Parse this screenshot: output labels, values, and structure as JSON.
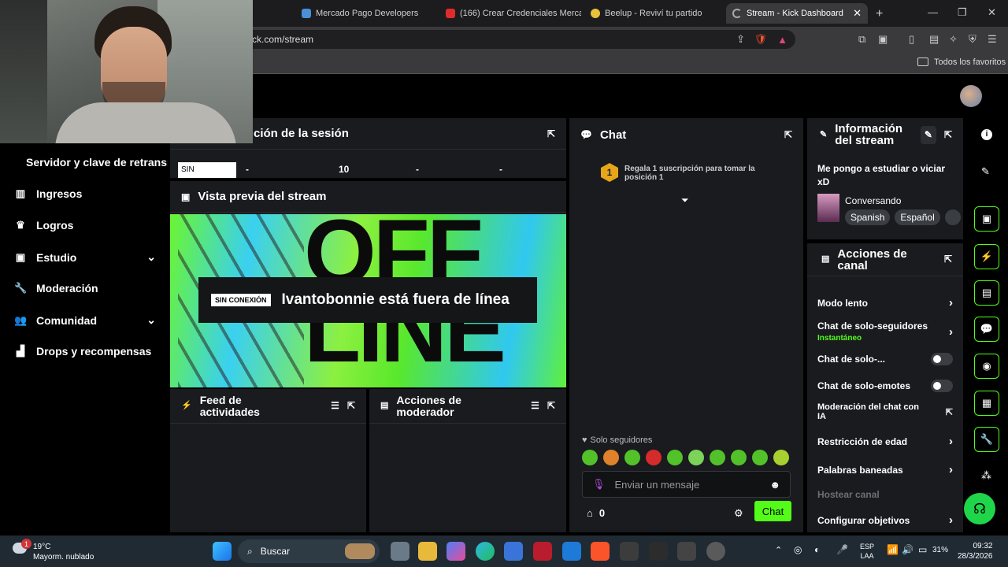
{
  "browser": {
    "tabs": [
      {
        "label": "Mercado Pago Developers",
        "color": "#4a8fd8"
      },
      {
        "label": "(166) Crear Credenciales Mercad",
        "color": "#e02b2b"
      },
      {
        "label": "Beelup - Reviví tu partido",
        "color": "#e7c23a"
      },
      {
        "label": "Stream - Kick Dashboard",
        "color": "#999999"
      }
    ],
    "url": "ck.com/stream",
    "bookmarks_label": "Todos los favoritos"
  },
  "sidebar": {
    "top_label": "Servidor y clave de retransn",
    "items": [
      {
        "label": "Ingresos",
        "icon": "chart-icon"
      },
      {
        "label": "Logros",
        "icon": "trophy-icon"
      },
      {
        "label": "Estudio",
        "icon": "studio-icon"
      },
      {
        "label": "Moderación",
        "icon": "wrench-icon"
      },
      {
        "label": "Comunidad",
        "icon": "community-icon"
      },
      {
        "label": "Drops y recompensas",
        "icon": "drops-icon"
      }
    ]
  },
  "session": {
    "title": "ción de la sesión",
    "cells": [
      "SIN",
      "-",
      "10",
      "-",
      "-"
    ]
  },
  "preview": {
    "title": "Vista previa del stream",
    "badge": "SIN CONEXIÓN",
    "offline_text": "Ivantobonnie está fuera de línea",
    "bg_text": "OFF\nLINE"
  },
  "activity": {
    "title": "Feed de actividades"
  },
  "mod_actions": {
    "title": "Acciones de moderador"
  },
  "chat": {
    "title": "Chat",
    "gift_rank": "1",
    "gift_text": "Regala 1 suscripción para tomar la posición 1",
    "followers_only": "Solo seguidores",
    "placeholder": "Enviar un mensaje",
    "count": "0",
    "send_label": "Chat"
  },
  "stream_info": {
    "title": "Información del stream",
    "stream_title": "Me pongo a estudiar o viciar xD",
    "category": "Conversando",
    "tags": [
      "Spanish",
      "Español"
    ]
  },
  "channel_actions": {
    "title": "Acciones de canal",
    "rows": [
      {
        "label": "Modo lento",
        "type": "arrow"
      },
      {
        "label": "Chat de solo-seguidores",
        "sub": "Instantáneo",
        "type": "arrow"
      },
      {
        "label": "Chat de solo-...",
        "type": "toggle"
      },
      {
        "label": "Chat de solo-emotes",
        "type": "toggle"
      },
      {
        "label": "Moderación del chat con IA",
        "type": "external"
      },
      {
        "label": "Restricción de edad",
        "type": "arrow"
      },
      {
        "label": "Palabras baneadas",
        "type": "arrow"
      },
      {
        "label": "Hostear canal",
        "type": "disabled"
      },
      {
        "label": "Configurar objetivos",
        "type": "arrow"
      }
    ]
  },
  "taskbar": {
    "weather_temp": "19°C",
    "weather_desc": "Mayorm. nublado",
    "search_label": "Buscar",
    "lang": "ESP",
    "lang2": "LAA",
    "battery": "31%",
    "time": "09:32",
    "date": "28/3/2026",
    "notif_count": "1"
  },
  "colors": {
    "accent": "#53fc18",
    "panel": "#191b1f"
  }
}
